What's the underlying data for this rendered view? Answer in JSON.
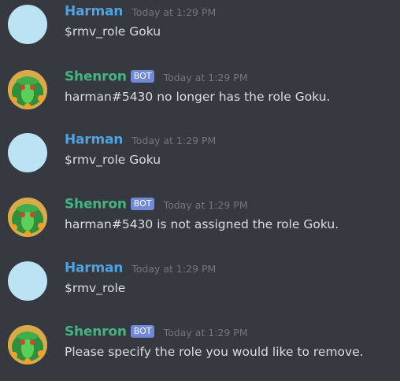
{
  "colors": {
    "background": "#36393f",
    "user_name": "#4fa3e0",
    "bot_name": "#43b581",
    "bot_badge": "#7289da",
    "timestamp": "#72767d",
    "message_text": "#dcddde"
  },
  "messages": [
    {
      "author": "Harman",
      "is_bot": false,
      "avatar": "light-blue-avatar-icon",
      "timestamp": "Today at 1:29 PM",
      "text": "$rmv_role Goku"
    },
    {
      "author": "Shenron",
      "is_bot": true,
      "badge": "BOT",
      "avatar": "dragon-avatar-icon",
      "timestamp": "Today at 1:29 PM",
      "text": "harman#5430 no longer has the role Goku."
    },
    {
      "author": "Harman",
      "is_bot": false,
      "avatar": "light-blue-avatar-icon",
      "timestamp": "Today at 1:29 PM",
      "text": "$rmv_role Goku"
    },
    {
      "author": "Shenron",
      "is_bot": true,
      "badge": "BOT",
      "avatar": "dragon-avatar-icon",
      "timestamp": "Today at 1:29 PM",
      "text": "harman#5430 is not assigned the role Goku."
    },
    {
      "author": "Harman",
      "is_bot": false,
      "avatar": "light-blue-avatar-icon",
      "timestamp": "Today at 1:29 PM",
      "text": "$rmv_role"
    },
    {
      "author": "Shenron",
      "is_bot": true,
      "badge": "BOT",
      "avatar": "dragon-avatar-icon",
      "timestamp": "Today at 1:29 PM",
      "text": "Please specify the role you would like to remove."
    }
  ]
}
